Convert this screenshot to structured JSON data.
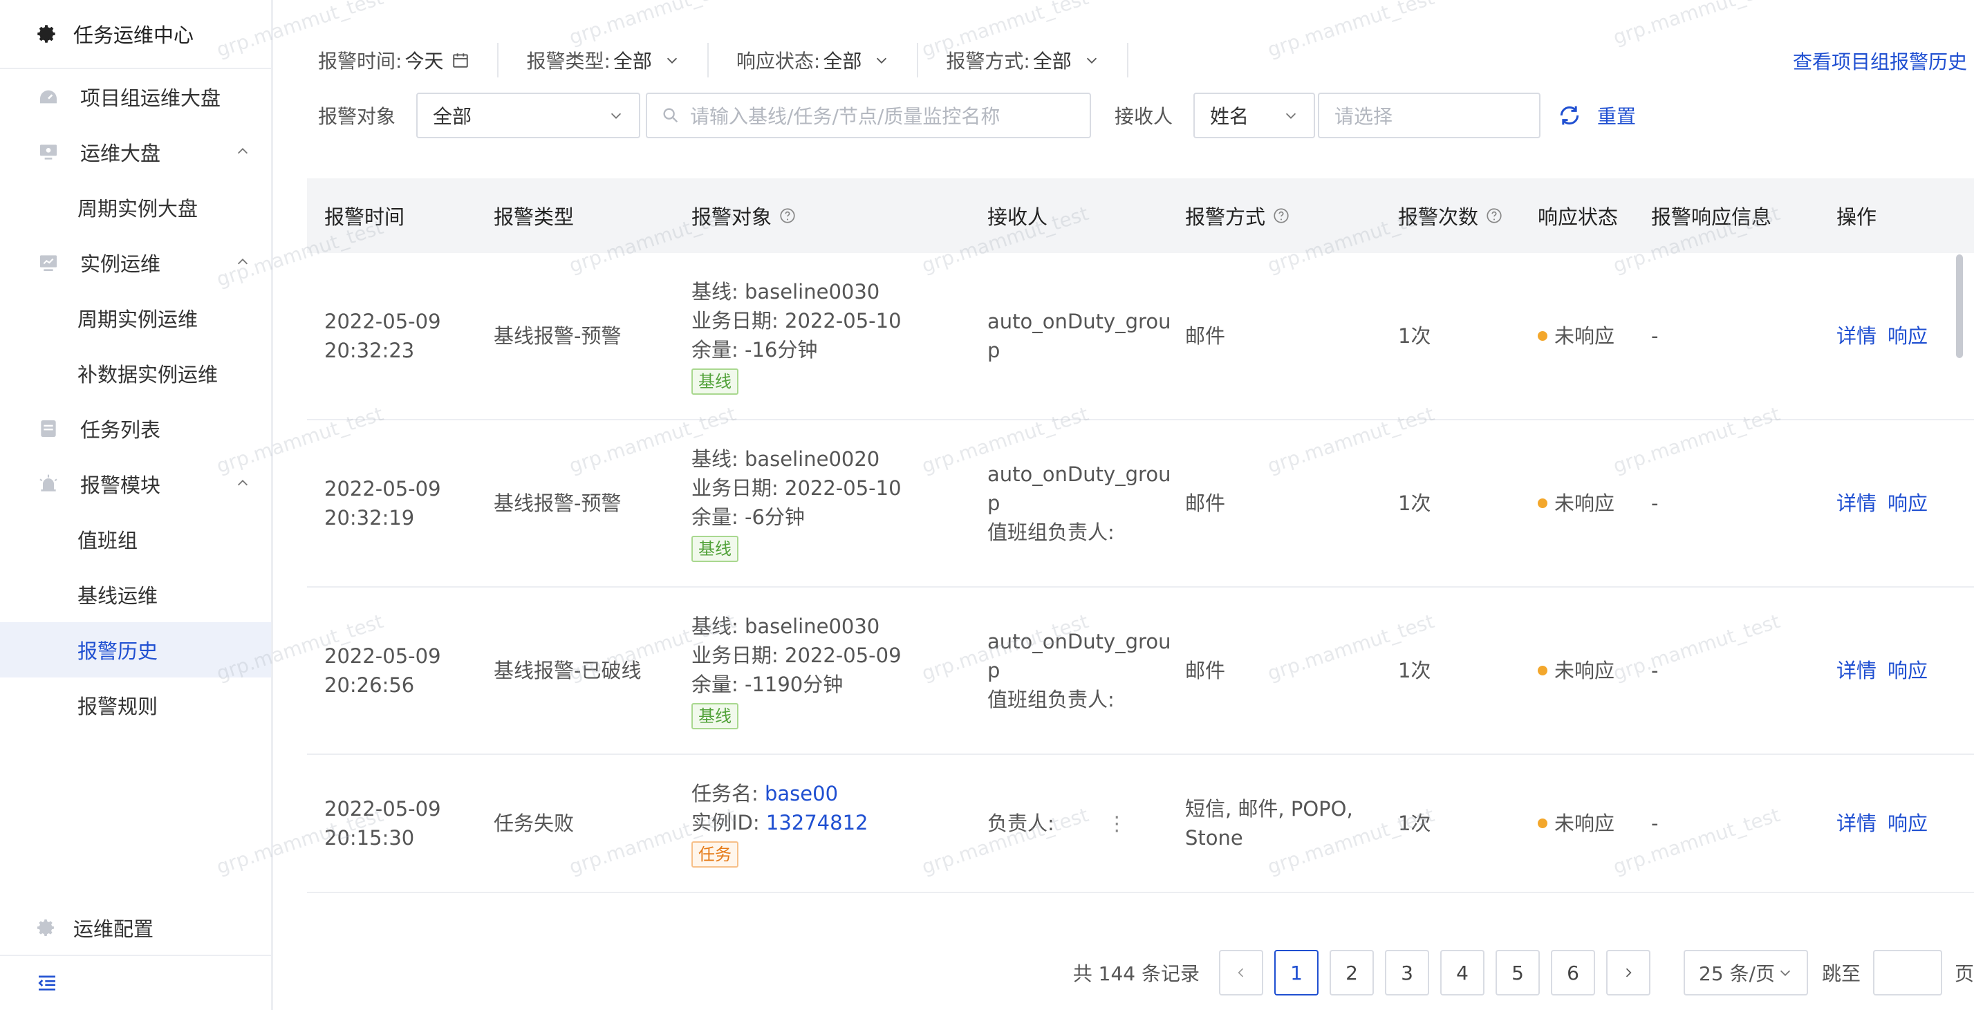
{
  "app": {
    "title": "任务运维中心",
    "watermark": "grp.mammut_test"
  },
  "sidebar": {
    "items": [
      {
        "label": "项目组运维大盘",
        "icon": "dashboard-icon",
        "level": "parent"
      },
      {
        "label": "运维大盘",
        "icon": "monitor-icon",
        "level": "parent",
        "expanded": true
      },
      {
        "label": "周期实例大盘",
        "level": "child"
      },
      {
        "label": "实例运维",
        "icon": "instance-icon",
        "level": "parent",
        "expanded": true
      },
      {
        "label": "周期实例运维",
        "level": "child"
      },
      {
        "label": "补数据实例运维",
        "level": "child"
      },
      {
        "label": "任务列表",
        "icon": "list-icon",
        "level": "parent"
      },
      {
        "label": "报警模块",
        "icon": "alarm-icon",
        "level": "parent",
        "expanded": true
      },
      {
        "label": "值班组",
        "level": "child"
      },
      {
        "label": "基线运维",
        "level": "child"
      },
      {
        "label": "报警历史",
        "level": "child",
        "active": true
      },
      {
        "label": "报警规则",
        "level": "child"
      }
    ],
    "config_label": "运维配置"
  },
  "filters": {
    "alarm_time_label": "报警时间:",
    "alarm_time_value": "今天",
    "alarm_type_label": "报警类型:",
    "alarm_type_value": "全部",
    "response_status_label": "响应状态:",
    "response_status_value": "全部",
    "alarm_method_label": "报警方式:",
    "alarm_method_value": "全部",
    "history_link": "查看项目组报警历史",
    "target_label": "报警对象",
    "target_value": "全部",
    "search_placeholder": "请输入基线/任务/节点/质量监控名称",
    "receiver_label": "接收人",
    "receiver_type_value": "姓名",
    "receiver_placeholder": "请选择",
    "reset_label": "重置"
  },
  "table": {
    "headers": {
      "time": "报警时间",
      "type": "报警类型",
      "target": "报警对象",
      "receiver": "接收人",
      "method": "报警方式",
      "count": "报警次数",
      "status": "响应状态",
      "response_info": "报警响应信息",
      "ops": "操作"
    },
    "rows": [
      {
        "date": "2022-05-09",
        "time": "20:32:23",
        "type": "基线报警-预警",
        "line1": "基线:  baseline0030",
        "line2": "业务日期:  2022-05-10",
        "line3": "余量:  -16分钟",
        "tag": "基线",
        "receiver1": "auto_onDuty_grou",
        "receiver2": "p",
        "receiver3": "",
        "method": "邮件",
        "count": "1次",
        "status": "未响应",
        "response_info": "-",
        "op_detail": "详情",
        "op_respond": "响应"
      },
      {
        "date": "2022-05-09",
        "time": "20:32:19",
        "type": "基线报警-预警",
        "line1": "基线:  baseline0020",
        "line2": "业务日期:  2022-05-10",
        "line3": "余量:  -6分钟",
        "tag": "基线",
        "receiver1": "auto_onDuty_grou",
        "receiver2": "p",
        "receiver3": "值班组负责人:",
        "method": "邮件",
        "count": "1次",
        "status": "未响应",
        "response_info": "-",
        "op_detail": "详情",
        "op_respond": "响应"
      },
      {
        "date": "2022-05-09",
        "time": "20:26:56",
        "type": "基线报警-已破线",
        "line1": "基线:  baseline0030",
        "line2": "业务日期:  2022-05-09",
        "line3": "余量:  -1190分钟",
        "tag": "基线",
        "receiver1": "auto_onDuty_grou",
        "receiver2": "p",
        "receiver3": "值班组负责人:",
        "method": "邮件",
        "count": "1次",
        "status": "未响应",
        "response_info": "-",
        "op_detail": "详情",
        "op_respond": "响应"
      },
      {
        "date": "2022-05-09",
        "time": "20:15:30",
        "type": "任务失败",
        "task_label": "任务名:",
        "task_value": "base00",
        "instance_label": "实例ID:",
        "instance_value": "13274812",
        "tag": "任务",
        "receiver1": "负责人:",
        "receiver_more": "⋮",
        "method1": "短信, 邮件, POPO,",
        "method2": "Stone",
        "count": "1次",
        "status": "未响应",
        "response_info": "-",
        "op_detail": "详情",
        "op_respond": "响应"
      }
    ]
  },
  "pagination": {
    "total": "共 144 条记录",
    "pages": [
      "1",
      "2",
      "3",
      "4",
      "5",
      "6"
    ],
    "current": "1",
    "page_size": "25 条/页",
    "jump_label": "跳至",
    "page_suffix": "页"
  },
  "colors": {
    "accent": "#1f4fd1",
    "status_pending": "#f3a72c",
    "tag_baseline": "#52a23a",
    "tag_task": "#e57a17"
  }
}
